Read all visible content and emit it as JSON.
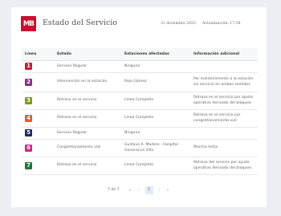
{
  "header": {
    "logo_text": "MB",
    "title": "Estado del Servicio",
    "date": "31 diciembre 2025",
    "update": "Actualización: 17:54"
  },
  "table": {
    "columns": [
      "Línea",
      "Estado",
      "Estaciones afectadas",
      "Información adicional"
    ],
    "rows": [
      {
        "line": "1",
        "color": "#c41e3a",
        "status": "Servicio Regular",
        "stations": "Ninguna",
        "info": ""
      },
      {
        "line": "2",
        "color": "#8e2c8c",
        "status": "Intervención en la estación",
        "stations": "Rojo Gómez",
        "info": "Por mantenimiento a la estación sin servicio en ambos sentidos"
      },
      {
        "line": "3",
        "color": "#7a9a1c",
        "status": "Retraso en el servicio",
        "stations": "Línea Completa",
        "info": "Retraso en el servicio por ajuste operativo derivado del bloqueo"
      },
      {
        "line": "4",
        "color": "#e85d24",
        "status": "Retraso en el servicio",
        "stations": "Línea Completa",
        "info": "Retraso en el servicio por congestionamiento vial"
      },
      {
        "line": "5",
        "color": "#1c2a5e",
        "status": "Servicio Regular",
        "stations": "Ninguna",
        "info": ""
      },
      {
        "line": "6",
        "color": "#d1247f",
        "status": "Congestionamiento vial",
        "stations": "Gustavo A. Madero - Hospital General La Villa",
        "info": "Marcha lenta"
      },
      {
        "line": "7",
        "color": "#1e7a3c",
        "status": "Retraso en el servicio",
        "stations": "Línea Completa",
        "info": "Retraso del servicio por ajuste operativo derivado del bloqueo"
      }
    ]
  },
  "pagination": {
    "info": "7 de 7",
    "first": "«",
    "prev": "‹",
    "current": "1",
    "next": "›",
    "last": "»"
  }
}
